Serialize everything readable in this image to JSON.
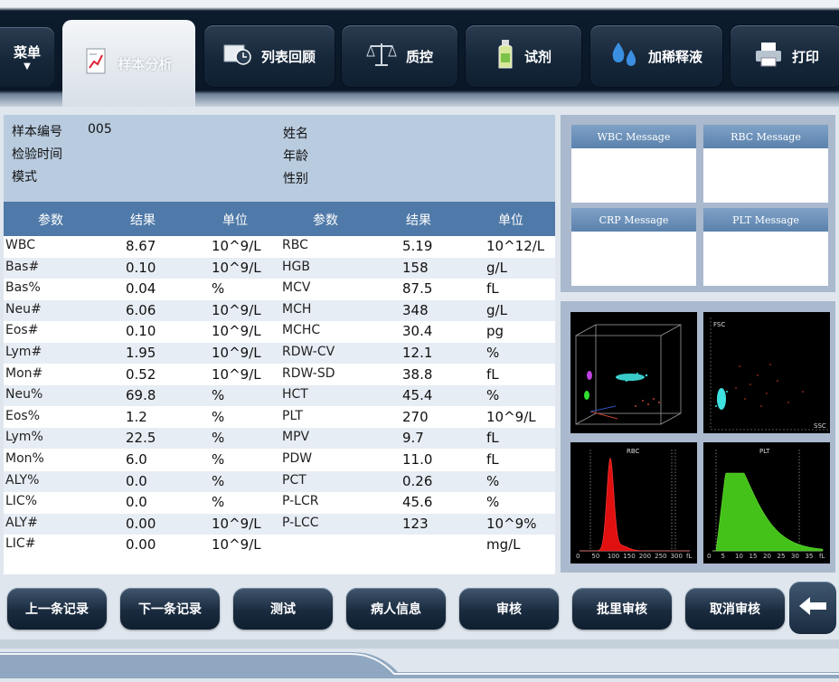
{
  "menu": {
    "label": "菜单"
  },
  "tabs": [
    {
      "label": "样本分析",
      "icon": "chart-icon"
    },
    {
      "label": "列表回顾",
      "icon": "clock-icon"
    },
    {
      "label": "质控",
      "icon": "scale-icon"
    },
    {
      "label": "试剂",
      "icon": "bottle-icon"
    },
    {
      "label": "加稀释液",
      "icon": "drops-icon"
    },
    {
      "label": "打印",
      "icon": "printer-icon"
    }
  ],
  "info": {
    "sample_no_label": "样本编号",
    "sample_no": "005",
    "test_time_label": "检验时间",
    "mode_label": "模式",
    "name_label": "姓名",
    "age_label": "年龄",
    "sex_label": "性别"
  },
  "table": {
    "headers": [
      "参数",
      "结果",
      "单位",
      "参数",
      "结果",
      "单位"
    ],
    "rows": [
      {
        "p1": "WBC",
        "r1": "8.67",
        "u1": "10^9/L",
        "p2": "RBC",
        "r2": "5.19",
        "u2": "10^12/L"
      },
      {
        "p1": "Bas#",
        "r1": "0.10",
        "u1": "10^9/L",
        "p2": "HGB",
        "r2": "158",
        "u2": "g/L"
      },
      {
        "p1": "Bas%",
        "r1": "0.04",
        "u1": "%",
        "p2": "MCV",
        "r2": "87.5",
        "u2": "fL"
      },
      {
        "p1": "Neu#",
        "r1": "6.06",
        "u1": "10^9/L",
        "p2": "MCH",
        "r2": "348",
        "u2": "g/L"
      },
      {
        "p1": "Eos#",
        "r1": "0.10",
        "u1": "10^9/L",
        "p2": "MCHC",
        "r2": "30.4",
        "u2": "pg"
      },
      {
        "p1": "Lym#",
        "r1": "1.95",
        "u1": "10^9/L",
        "p2": "RDW-CV",
        "r2": "12.1",
        "u2": "%"
      },
      {
        "p1": "Mon#",
        "r1": "0.52",
        "u1": "10^9/L",
        "p2": "RDW-SD",
        "r2": "38.8",
        "u2": "fL"
      },
      {
        "p1": "Neu%",
        "r1": "69.8",
        "u1": "%",
        "p2": "HCT",
        "r2": "45.4",
        "u2": "%"
      },
      {
        "p1": "Eos%",
        "r1": "1.2",
        "u1": "%",
        "p2": "PLT",
        "r2": "270",
        "u2": "10^9/L"
      },
      {
        "p1": "Lym%",
        "r1": "22.5",
        "u1": "%",
        "p2": "MPV",
        "r2": "9.7",
        "u2": "fL"
      },
      {
        "p1": "Mon%",
        "r1": "6.0",
        "u1": "%",
        "p2": "PDW",
        "r2": "11.0",
        "u2": "fL"
      },
      {
        "p1": "ALY%",
        "r1": "0.0",
        "u1": "%",
        "p2": "PCT",
        "r2": "0.26",
        "u2": "%"
      },
      {
        "p1": "LIC%",
        "r1": "0.0",
        "u1": "%",
        "p2": "P-LCR",
        "r2": "45.6",
        "u2": "%"
      },
      {
        "p1": "ALY#",
        "r1": "0.00",
        "u1": "10^9/L",
        "p2": "P-LCC",
        "r2": "123",
        "u2": "10^9%"
      },
      {
        "p1": "LIC#",
        "r1": "0.00",
        "u1": "10^9/L",
        "p2": "",
        "r2": "",
        "u2": "mg/L"
      }
    ]
  },
  "messages": {
    "wbc": "WBC Message",
    "rbc": "RBC Message",
    "crp": "CRP Message",
    "plt": "PLT Message"
  },
  "plots": {
    "fsc_label": "FSC",
    "ssc_label": "SSC",
    "rbc_label": "RBC",
    "plt_label": "PLT",
    "rbc_axis": [
      "0",
      "50",
      "100",
      "150",
      "200",
      "250",
      "300",
      "fL"
    ],
    "plt_axis": [
      "0",
      "5",
      "10",
      "15",
      "20",
      "25",
      "30",
      "35",
      "fL"
    ],
    "colors": {
      "rbc": "#e01010",
      "plt": "#44c21a",
      "cyan": "#3fe0e0",
      "magenta": "#c040e0",
      "green": "#30e030"
    }
  },
  "buttons": [
    "上一条记录",
    "下一条记录",
    "测试",
    "病人信息",
    "审核",
    "批里审核",
    "取消审核"
  ],
  "back_icon": "arrow-left-icon"
}
